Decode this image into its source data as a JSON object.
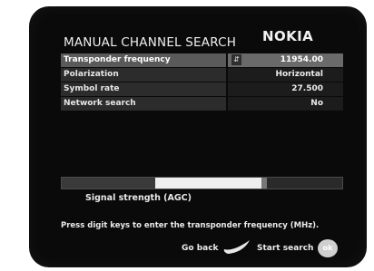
{
  "screen": {
    "title": "MANUAL CHANNEL SEARCH",
    "brand": "NOKIA"
  },
  "settings": [
    {
      "label": "Transponder frequency",
      "value": "11954.00",
      "selected": true,
      "has_arrow": true
    },
    {
      "label": "Polarization",
      "value": "Horizontal",
      "selected": false
    },
    {
      "label": "Symbol rate",
      "value": "27.500",
      "selected": false
    },
    {
      "label": "Network search",
      "value": "No",
      "selected": false
    }
  ],
  "signal": {
    "label": "Signal strength (AGC)",
    "level_fraction": 0.73
  },
  "hint": "Press digit keys to enter the transponder frequency (MHz).",
  "footer": {
    "go_back_label": "Go back",
    "start_search_label": "Start search",
    "ok_label": "ok"
  },
  "icons": {
    "arrow": "up-down-arrow-icon",
    "back": "back-key-icon",
    "ok": "ok-button-icon"
  }
}
